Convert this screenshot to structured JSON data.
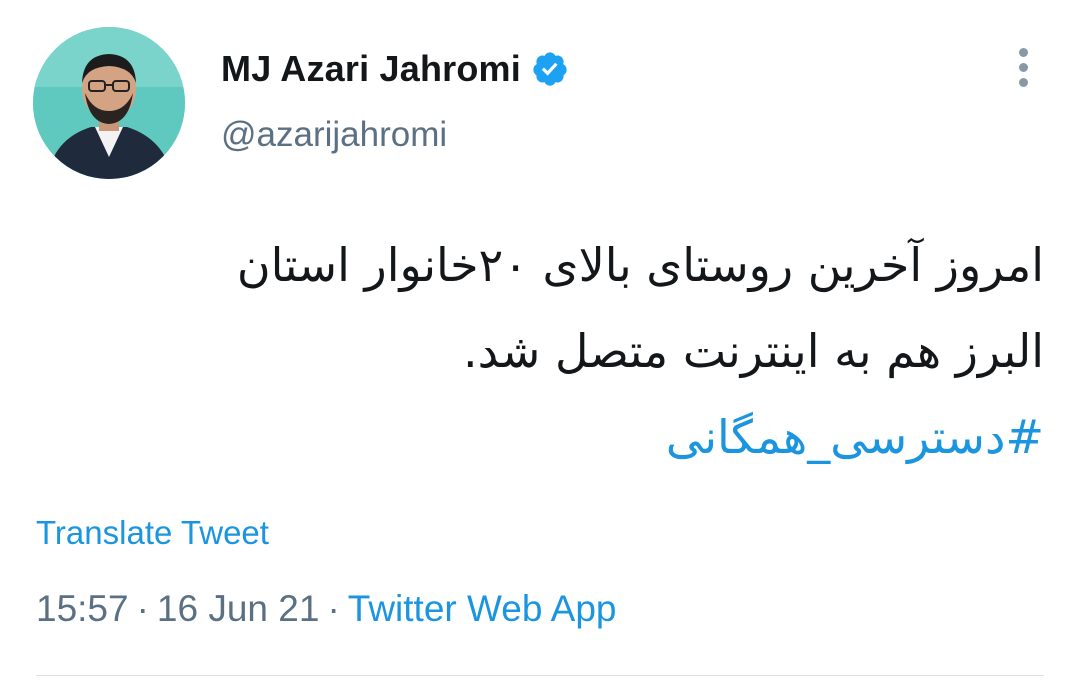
{
  "author": {
    "display_name": "MJ Azari Jahromi",
    "handle": "@azarijahromi",
    "verified": true
  },
  "tweet": {
    "text_lines": [
      "امروز آخرین روستای بالای ۲۰خانوار استان",
      "البرز هم به اینترنت متصل شد."
    ],
    "hashtag": "#دسترسی_همگانی",
    "translate_label": "Translate Tweet"
  },
  "meta": {
    "time": "15:57",
    "date": "16 Jun 21",
    "separator": "·",
    "source": "Twitter Web App"
  },
  "icons": {
    "verified": "verified-badge-icon",
    "more": "more-options-icon"
  },
  "colors": {
    "link": "#1b95e0",
    "secondary_text": "#5b7083",
    "primary_text": "#14171a",
    "avatar_background": "#5fc9bf"
  }
}
